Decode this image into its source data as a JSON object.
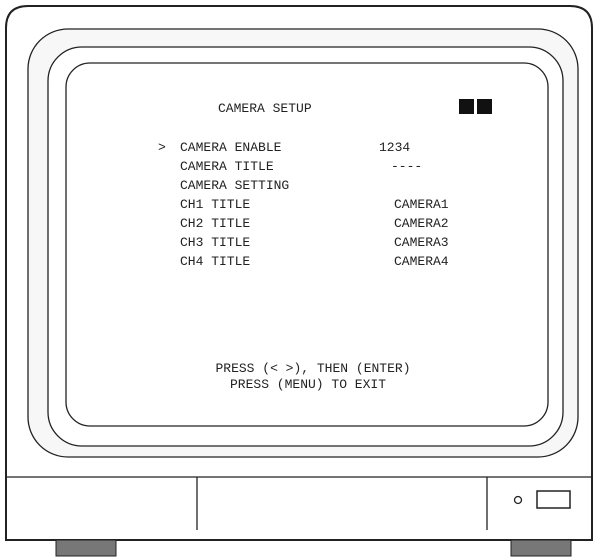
{
  "screen": {
    "title": "CAMERA SETUP",
    "cursor": ">",
    "menu": [
      {
        "label": "CAMERA ENABLE",
        "value": "1234"
      },
      {
        "label": "CAMERA TITLE",
        "value": "----"
      },
      {
        "label": "CAMERA SETTING",
        "value": ""
      },
      {
        "label": "CH1 TITLE",
        "value": "CAMERA1"
      },
      {
        "label": "CH2 TITLE",
        "value": "CAMERA2"
      },
      {
        "label": "CH3 TITLE",
        "value": "CAMERA3"
      },
      {
        "label": "CH4 TITLE",
        "value": "CAMERA4"
      }
    ],
    "hint_line1": "PRESS (< >), THEN (ENTER)",
    "hint_line2": "PRESS (MENU) TO EXIT"
  }
}
